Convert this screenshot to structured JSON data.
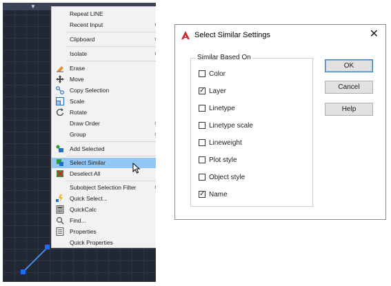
{
  "context_menu": {
    "items": [
      {
        "label": "Repeat LINE",
        "icon": "none",
        "submenu": false
      },
      {
        "label": "Recent Input",
        "icon": "none",
        "submenu": true
      },
      {
        "label": "Clipboard",
        "icon": "none",
        "submenu": true
      },
      {
        "label": "Isolate",
        "icon": "none",
        "submenu": true
      },
      {
        "label": "Erase",
        "icon": "erase-icon",
        "submenu": false
      },
      {
        "label": "Move",
        "icon": "move-icon",
        "submenu": false
      },
      {
        "label": "Copy Selection",
        "icon": "copy-icon",
        "submenu": false
      },
      {
        "label": "Scale",
        "icon": "scale-icon",
        "submenu": false
      },
      {
        "label": "Rotate",
        "icon": "rotate-icon",
        "submenu": false
      },
      {
        "label": "Draw Order",
        "icon": "none",
        "submenu": true
      },
      {
        "label": "Group",
        "icon": "none",
        "submenu": true
      },
      {
        "label": "Add Selected",
        "icon": "add-selected-icon",
        "submenu": false
      },
      {
        "label": "Select Similar",
        "icon": "select-similar-icon",
        "submenu": false,
        "highlighted": true
      },
      {
        "label": "Deselect All",
        "icon": "deselect-all-icon",
        "submenu": false
      },
      {
        "label": "Subobject Selection Filter",
        "icon": "none",
        "submenu": true
      },
      {
        "label": "Quick Select...",
        "icon": "quick-select-icon",
        "submenu": false
      },
      {
        "label": "QuickCalc",
        "icon": "calculator-icon",
        "submenu": false
      },
      {
        "label": "Find...",
        "icon": "find-icon",
        "submenu": false
      },
      {
        "label": "Properties",
        "icon": "properties-icon",
        "submenu": false
      },
      {
        "label": "Quick Properties",
        "icon": "quick-properties-icon",
        "submenu": false
      }
    ],
    "highlight_color": "#91c8f6",
    "submenu_arrow": "›"
  },
  "canvas": {
    "background_color": "#212834",
    "line_color": "#3f8fe6",
    "grip_color": "#1d6cff"
  },
  "dialog": {
    "title": "Select Similar Settings",
    "close_glyph": "✕",
    "group_label": "Similar Based On",
    "options": [
      {
        "label": "Color",
        "checked": false
      },
      {
        "label": "Layer",
        "checked": true
      },
      {
        "label": "Linetype",
        "checked": false
      },
      {
        "label": "Linetype scale",
        "checked": false
      },
      {
        "label": "Lineweight",
        "checked": false
      },
      {
        "label": "Plot style",
        "checked": false
      },
      {
        "label": "Object style",
        "checked": false
      },
      {
        "label": "Name",
        "checked": true
      }
    ],
    "buttons": {
      "ok": "OK",
      "cancel": "Cancel",
      "help": "Help"
    },
    "check_glyph": "✓"
  }
}
